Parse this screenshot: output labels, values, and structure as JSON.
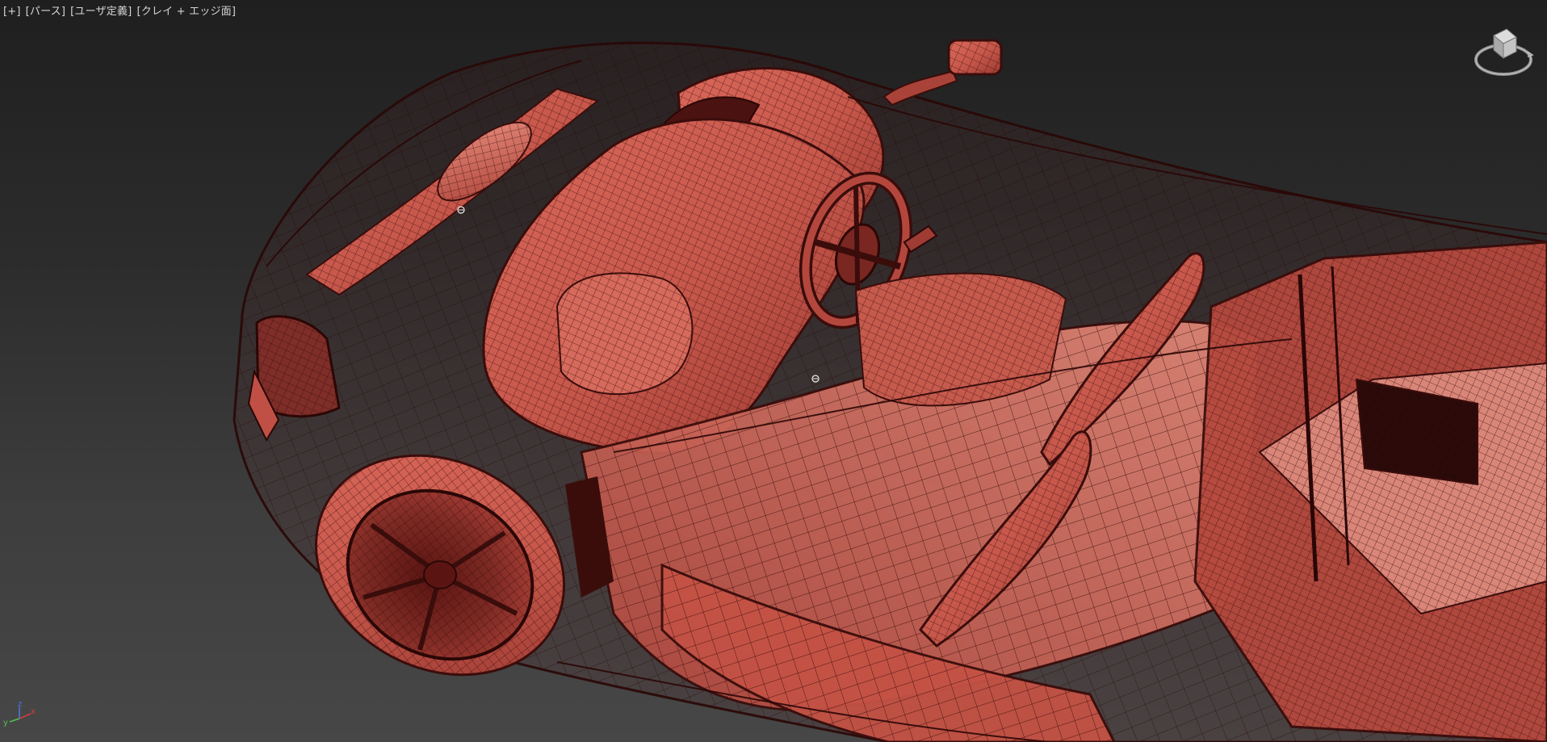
{
  "viewport": {
    "labels": [
      {
        "id": "plus",
        "text": "[+]"
      },
      {
        "id": "view",
        "text": "[パース]"
      },
      {
        "id": "shading-preset",
        "text": "[ユーザ定義]"
      },
      {
        "id": "display-mode",
        "text": "[クレイ + エッジ面]"
      }
    ],
    "model_description": "red clay wireframe sports car chassis viewed from above",
    "colors": {
      "background_top": "#1f1f1f",
      "background_bottom": "#474747",
      "clay": "#c8584c",
      "clay_light": "#e08070",
      "clay_dark": "#8a2f2a",
      "wire": "#3a0d0b"
    }
  },
  "axis_tripod": {
    "x_label": "x",
    "y_label": "y",
    "z_label": "z",
    "colors": {
      "x": "#d23b3b",
      "y": "#4fbf4f",
      "z": "#4a78e8"
    }
  },
  "viewcube": {
    "icon": "viewcube-icon"
  },
  "hud_icons": [
    {
      "name": "gizmo-pivot-icon-1"
    },
    {
      "name": "gizmo-pivot-icon-2"
    }
  ]
}
